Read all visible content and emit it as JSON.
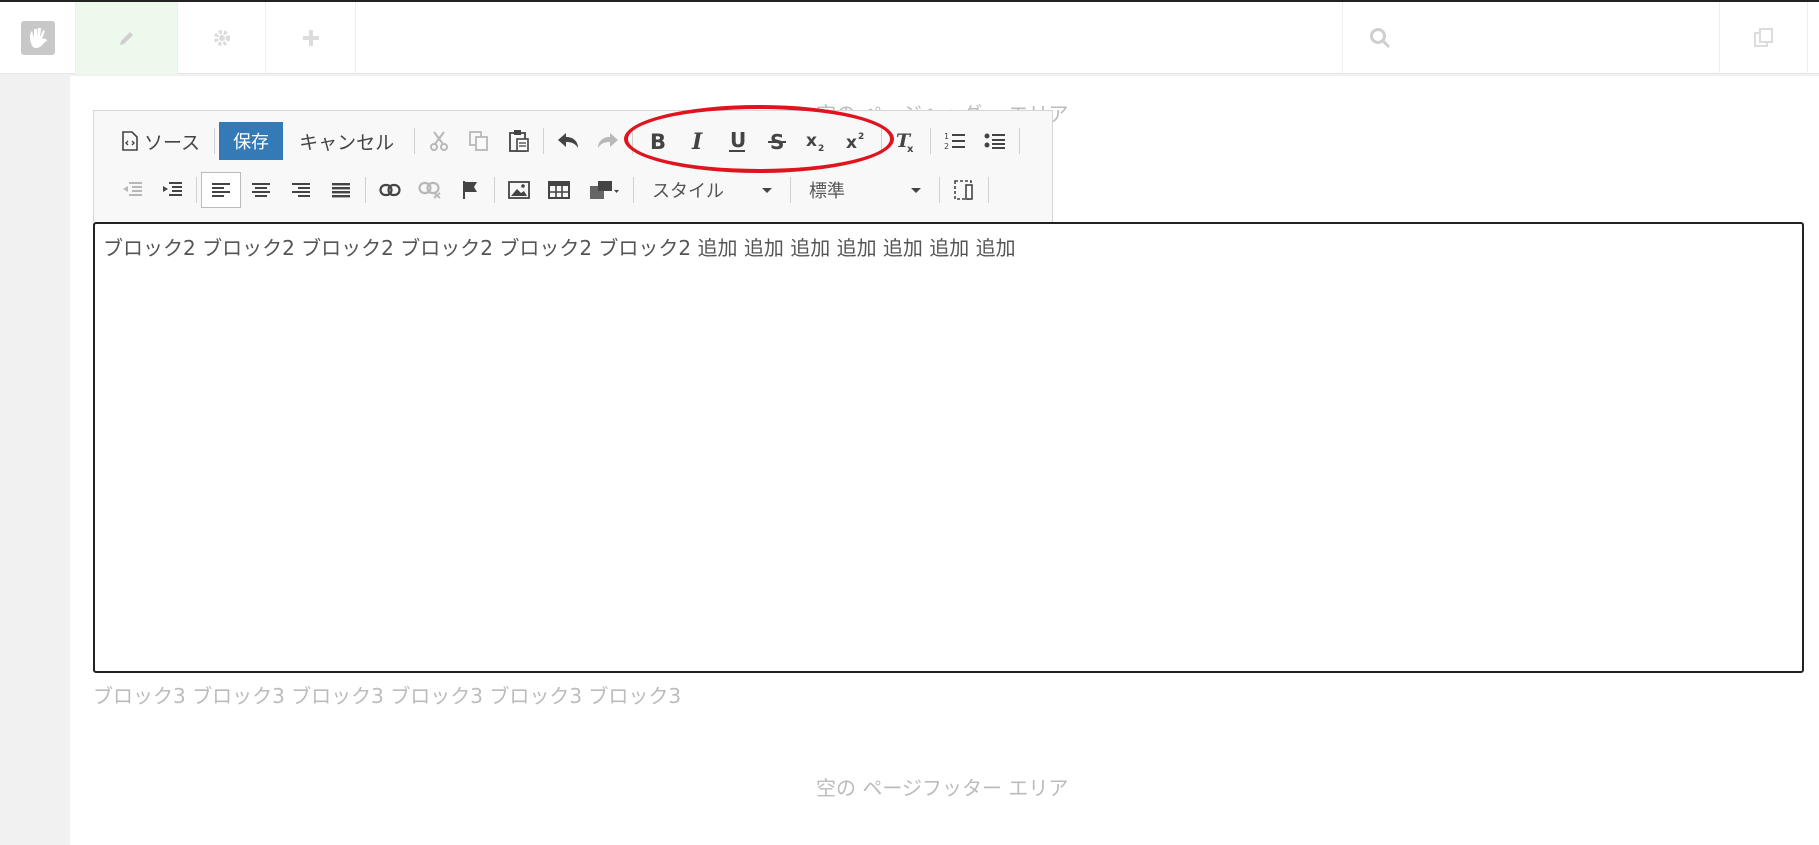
{
  "topbar": {
    "icons": [
      "concrete-hand-icon",
      "pencil-icon",
      "gear-icon",
      "plus-icon",
      "search-icon",
      "pages-icon"
    ]
  },
  "header_area": "空の ページヘッダー エリア",
  "toolbar": {
    "source_label": "ソース",
    "save_label": "保存",
    "cancel_label": "キャンセル",
    "style_label": "スタイル",
    "format_label": "標準"
  },
  "editor": {
    "content": "ブロック2 ブロック2 ブロック2 ブロック2 ブロック2 ブロック2 追加 追加 追加 追加 追加 追加 追加"
  },
  "block3": "ブロック3 ブロック3 ブロック3 ブロック3 ブロック3 ブロック3",
  "footer_area": "空の ページフッター エリア",
  "colors": {
    "save": "#337ab7",
    "highlight_ellipse": "#e0141e",
    "edit_active": "#eef9ee"
  }
}
